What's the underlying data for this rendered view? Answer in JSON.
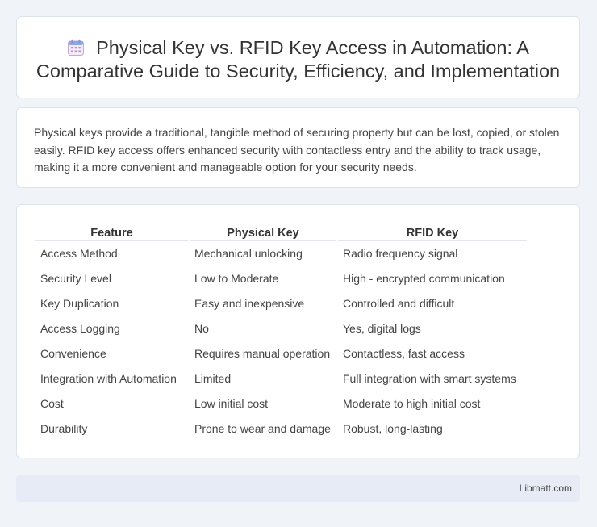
{
  "header": {
    "icon": "calendar-icon",
    "title": "Physical Key vs. RFID Key Access in Automation: A Comparative Guide to Security, Efficiency, and Implementation"
  },
  "summary": "Physical keys provide a traditional, tangible method of securing property but can be lost, copied, or stolen easily. RFID key access offers enhanced security with contactless entry and the ability to track usage, making it a more convenient and manageable option for your security needs.",
  "table": {
    "headers": [
      "Feature",
      "Physical Key",
      "RFID Key"
    ],
    "rows": [
      [
        "Access Method",
        "Mechanical unlocking",
        "Radio frequency signal"
      ],
      [
        "Security Level",
        "Low to Moderate",
        "High - encrypted communication"
      ],
      [
        "Key Duplication",
        "Easy and inexpensive",
        "Controlled and difficult"
      ],
      [
        "Access Logging",
        "No",
        "Yes, digital logs"
      ],
      [
        "Convenience",
        "Requires manual operation",
        "Contactless, fast access"
      ],
      [
        "Integration with Automation",
        "Limited",
        "Full integration with smart systems"
      ],
      [
        "Cost",
        "Low initial cost",
        "Moderate to high initial cost"
      ],
      [
        "Durability",
        "Prone to wear and damage",
        "Robust, long-lasting"
      ]
    ]
  },
  "footer": {
    "brand": "Libmatt.com"
  }
}
